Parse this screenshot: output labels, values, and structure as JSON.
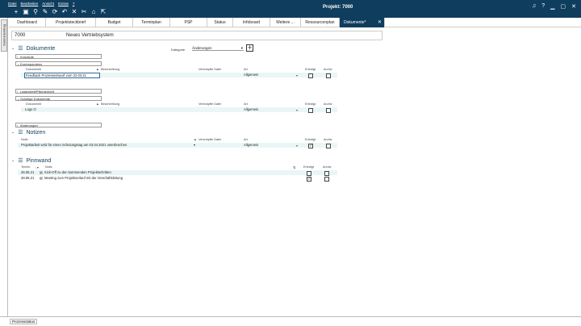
{
  "menu": [
    "Datei",
    "Bearbeiten",
    "Ansicht",
    "Extras",
    "?"
  ],
  "project_title": "Projekt: 7000",
  "side_tab": "Sammeleintrag",
  "tabs": [
    "Dashboard",
    "Projektsteckbrief",
    "Budget",
    "Terminplan",
    "PSP",
    "Status",
    "Infoboard",
    "Weitere ...",
    "Ressourcenplan",
    "Dokumente*"
  ],
  "header": {
    "num": "7000",
    "name": "Neues Vertriebsystem"
  },
  "kategorie": {
    "label": "Kategorie",
    "value": "Änderungen"
  },
  "dokumente": {
    "title": "Dokumente",
    "groups": [
      "Konzepte",
      "Korrespondenz",
      "Lastenheft/Pflichtenheft",
      "Sonstige Dokumente",
      "Änderungen"
    ],
    "columns": {
      "dok": "Dokumente",
      "beschreibung": "Beschreibung",
      "verkn": "Verknüpfte Datei",
      "art": "Art",
      "erledigt": "Erledigt",
      "archiv": "Archiv"
    },
    "korr_row": {
      "dok": "Feedback Prozessentwurf vom 22.03.21",
      "art": "Allgemein"
    },
    "sonst_row": {
      "dok": "Logo O",
      "art": "Allgemein"
    }
  },
  "notizen": {
    "title": "Notizen",
    "columns": {
      "notiz": "Notiz",
      "verkn": "Verknüpfte Datei",
      "art": "Art",
      "erledigt": "Erledigt",
      "archiv": "Archiv"
    },
    "row": {
      "notiz": "Projektarbeit wird für einen Schulungstag am 03.04.2021 unterbrochen",
      "art": "Allgemein",
      "erledigt": true
    }
  },
  "pinnwand": {
    "title": "Pinnwand",
    "columns": {
      "termin": "Termin",
      "notiz": "Notiz",
      "erledigt": "Erledigt",
      "archiv": "Archiv"
    },
    "rows": [
      {
        "termin": "26.05.21",
        "notiz": "Kick-Off zu den kommenden Projektschritten",
        "erledigt": false
      },
      {
        "termin": "28.05.21",
        "notiz": "Meeting zum Projektverlauf mit der Geschäftsleitung",
        "erledigt": true
      }
    ]
  },
  "status_label": "Prozessstatus",
  "colors": {
    "brand": "#0f3d5e",
    "rowbg": "#eaf6f6"
  }
}
